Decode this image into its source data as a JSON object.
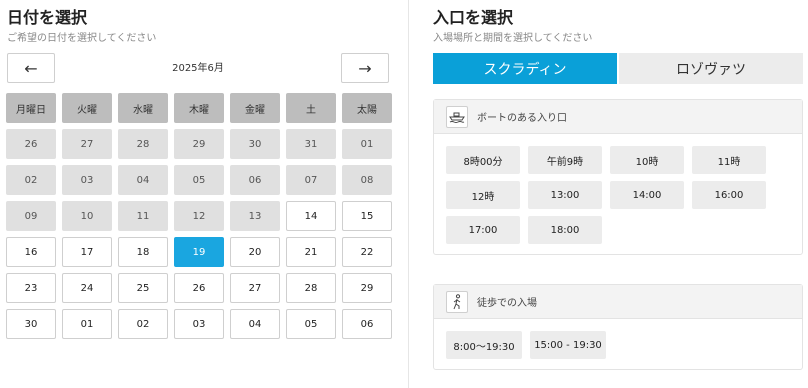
{
  "date_panel": {
    "title": "日付を選択",
    "subtitle": "ご希望の日付を選択してください",
    "prev_label": "←",
    "next_label": "→",
    "month_label": "2025年6月",
    "weekdays": [
      "月曜日",
      "火曜",
      "水曜",
      "木曜",
      "金曜",
      "土",
      "太陽"
    ],
    "weeks": [
      [
        "26",
        "27",
        "28",
        "29",
        "30",
        "31",
        "01"
      ],
      [
        "02",
        "03",
        "04",
        "05",
        "06",
        "07",
        "08"
      ],
      [
        "09",
        "10",
        "11",
        "12",
        "13",
        "14",
        "15"
      ],
      [
        "16",
        "17",
        "18",
        "19",
        "20",
        "21",
        "22"
      ],
      [
        "23",
        "24",
        "25",
        "26",
        "27",
        "28",
        "29"
      ],
      [
        "30",
        "01",
        "02",
        "03",
        "04",
        "05",
        "06"
      ]
    ],
    "selected_label": "19",
    "accent_color": "#1aa6e0"
  },
  "entrance_panel": {
    "title": "入口を選択",
    "subtitle": "入場場所と期間を選択してください",
    "tabs": [
      {
        "label": "スクラディン",
        "active": true
      },
      {
        "label": "ロゾヴァツ",
        "active": false
      }
    ],
    "sections": [
      {
        "icon": "boat-icon",
        "label": "ボートのある入り口",
        "slots": [
          "8時00分",
          "午前9時",
          "10時",
          "11時",
          "12時",
          "13:00",
          "14:00",
          "16:00",
          "17:00",
          "18:00"
        ]
      },
      {
        "icon": "walking-person-icon",
        "label": "徒歩での入場",
        "slots": [
          "8:00〜19:30",
          "15:00 - 19:30"
        ]
      }
    ]
  }
}
